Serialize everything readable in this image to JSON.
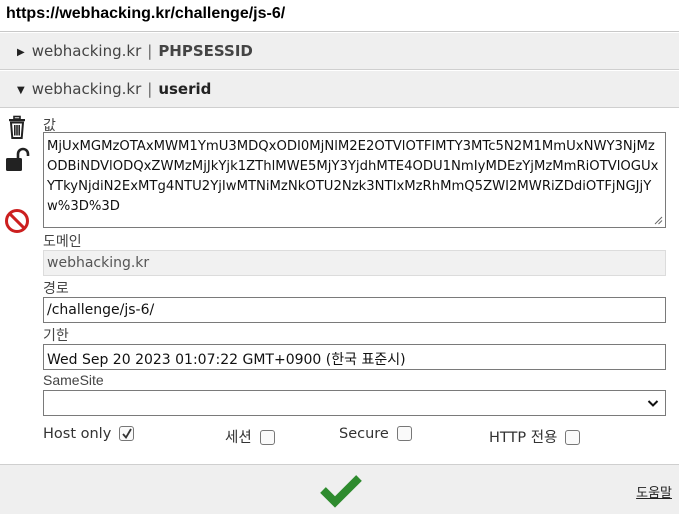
{
  "url": "https://webhacking.kr/challenge/js-6/",
  "cookies": [
    {
      "domain": "webhacking.kr",
      "separator": "|",
      "name": "PHPSESSID",
      "expanded": false
    },
    {
      "domain": "webhacking.kr",
      "separator": "|",
      "name": "userid",
      "expanded": true
    }
  ],
  "editor": {
    "value_label": "값",
    "value": "MjUxMGMzOTAxMWM1YmU3MDQxODI0MjNlM2E2OTVlOTFlMTY3MTc5N2M1MmUxNWY3NjMzODBiNDVlODQxZWMzMjJkYjk1ZThlMWE5MjY3YjdhMTE4ODU1NmIyMDEzYjMzMmRiOTVlOGUxYTkyNjdiN2ExMTg4NTU2YjIwMTNiMzNkOTU2Nzk3NTIxMzRhMmQ5ZWI2MWRiZDdiOTFjNGJjYw%3D%3D",
    "domain_label": "도메인",
    "domain_value": "webhacking.kr",
    "path_label": "경로",
    "path_value": "/challenge/js-6/",
    "expires_label": "기한",
    "expires_value": "Wed Sep 20 2023 01:07:22 GMT+0900 (한국 표준시)",
    "samesite_label": "SameSite",
    "samesite_value": "",
    "checkboxes": [
      {
        "label": "Host only",
        "checked": true
      },
      {
        "label": "세션",
        "checked": false
      },
      {
        "label": "Secure",
        "checked": false
      },
      {
        "label": "HTTP 전용",
        "checked": false
      }
    ]
  },
  "side_icons": [
    "trash-icon",
    "unlock-icon",
    "block-icon"
  ],
  "footer": {
    "save_icon": "checkmark-icon",
    "help_label": "도움말"
  },
  "colors": {
    "save_green": "#2e8b2e",
    "block_red": "#cc1f1f",
    "header_bg": "#efefef"
  }
}
